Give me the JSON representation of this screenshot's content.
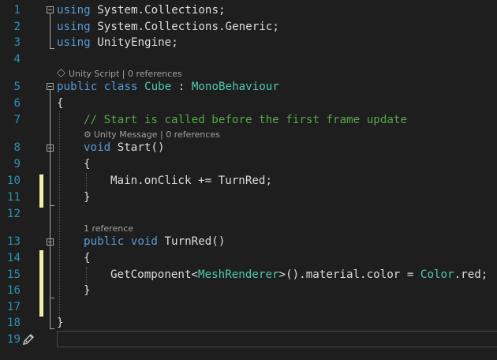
{
  "editor": {
    "line_numbers": [
      "1",
      "2",
      "3",
      "4",
      "5",
      "6",
      "7",
      "8",
      "9",
      "10",
      "11",
      "12",
      "13",
      "14",
      "15",
      "16",
      "17",
      "18",
      "19"
    ],
    "line1": {
      "kw": "using",
      "ns": " System.Collections;"
    },
    "line2": {
      "kw": "using",
      "ns": " System.Collections.Generic;"
    },
    "line3": {
      "kw": "using",
      "ns": " UnityEngine;"
    },
    "lens_class": {
      "a": "Unity Script",
      "sep": " | ",
      "b": "0 references"
    },
    "line5": {
      "kw1": "public",
      "kw2": " class ",
      "name": "Cube",
      "colon": " : ",
      "base": "MonoBehaviour"
    },
    "line6": "{",
    "line7": "// Start is called before the first frame update",
    "lens_start": {
      "a": "Unity Message",
      "sep": " | ",
      "b": "0 references"
    },
    "line8": {
      "kw": "void",
      "rest": " Start()"
    },
    "line9": "{",
    "line10": "Main.onClick += TurnRed;",
    "line11": "}",
    "lens_turnred": "1 reference",
    "line13": {
      "kw1": "public",
      "kw2": " void",
      "rest": " TurnRed()"
    },
    "line14": "{",
    "line15": {
      "a": "GetComponent<",
      "type": "MeshRenderer",
      "b": ">().material.color = ",
      "type2": "Color",
      "c": ".red;"
    },
    "line16": "}",
    "line18": "}",
    "colors": {
      "keyword": "#569cd6",
      "type": "#4ec9b0",
      "comment": "#57a64a",
      "line_number": "#2b91af",
      "change_bar": "#efefa8"
    },
    "icons": [
      "fold-collapse-icon",
      "unity-cube-icon",
      "gear-icon",
      "pencil-edit-icon"
    ]
  }
}
